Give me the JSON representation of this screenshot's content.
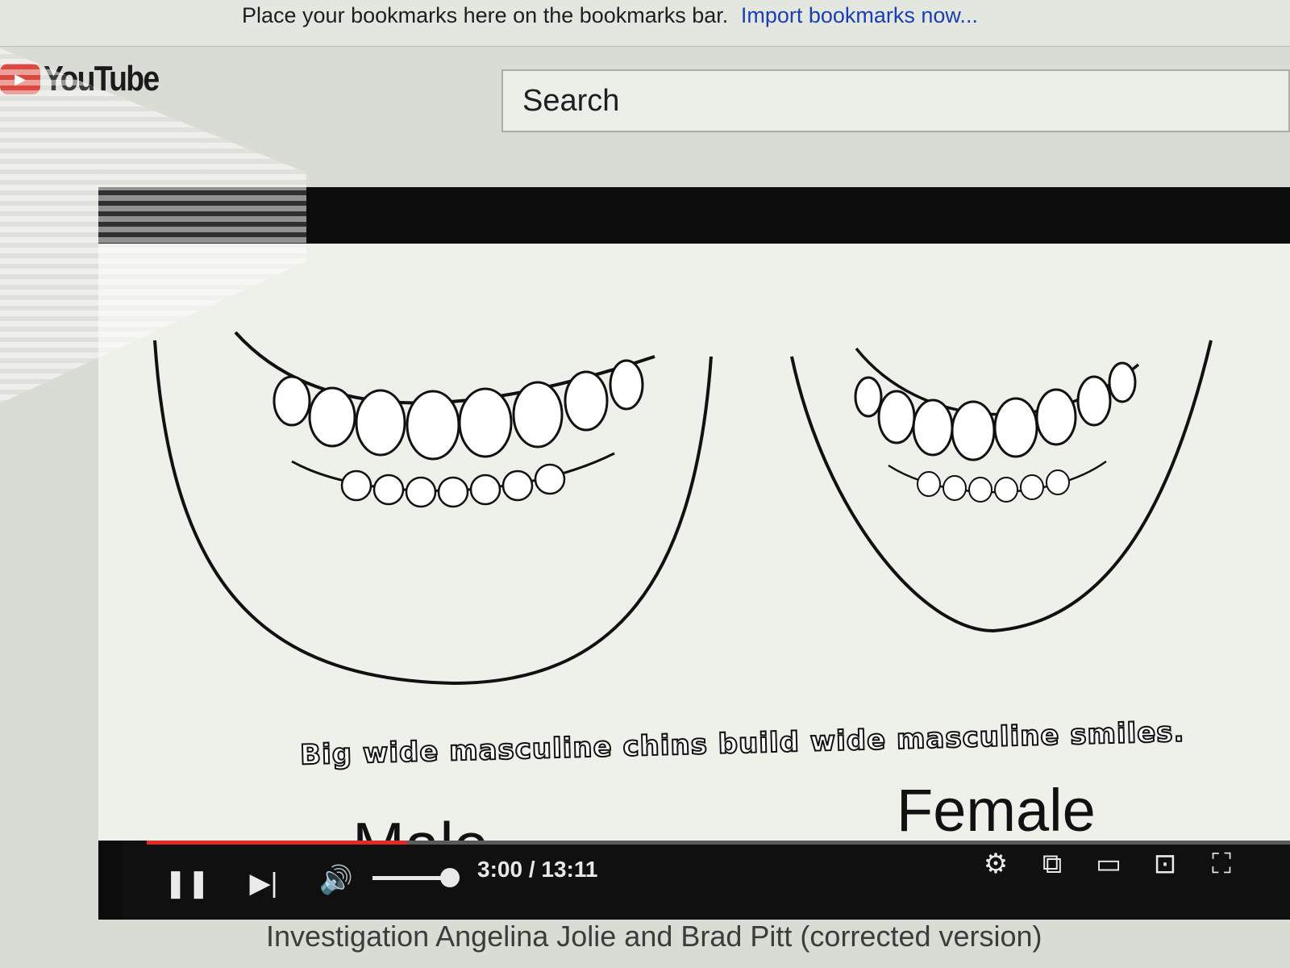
{
  "browser": {
    "bookmarks_bar_text": "Place your bookmarks here on the bookmarks bar.",
    "bookmarks_bar_link": "Import bookmarks now..."
  },
  "header": {
    "logo_text": "YouTube",
    "search_placeholder": "Search"
  },
  "player": {
    "caption": "Big wide masculine chins build  wide masculine smiles.",
    "label_male": "Male",
    "label_female": "Female",
    "current_time": "3:00",
    "duration": "13:11",
    "time_display": "3:00 / 13:11",
    "progress_fraction": 0.228,
    "volume_fraction": 0.8,
    "icons": {
      "pause": "pause-icon",
      "next": "next-icon",
      "volume": "volume-icon",
      "settings": "gear-icon",
      "miniplayer": "miniplayer-icon",
      "theater": "theater-mode-icon",
      "cast": "cast-icon",
      "fullscreen": "fullscreen-icon"
    },
    "accent_color": "#e02b26"
  },
  "video": {
    "title": "Investigation Angelina Jolie and Brad Pitt (corrected version)"
  }
}
